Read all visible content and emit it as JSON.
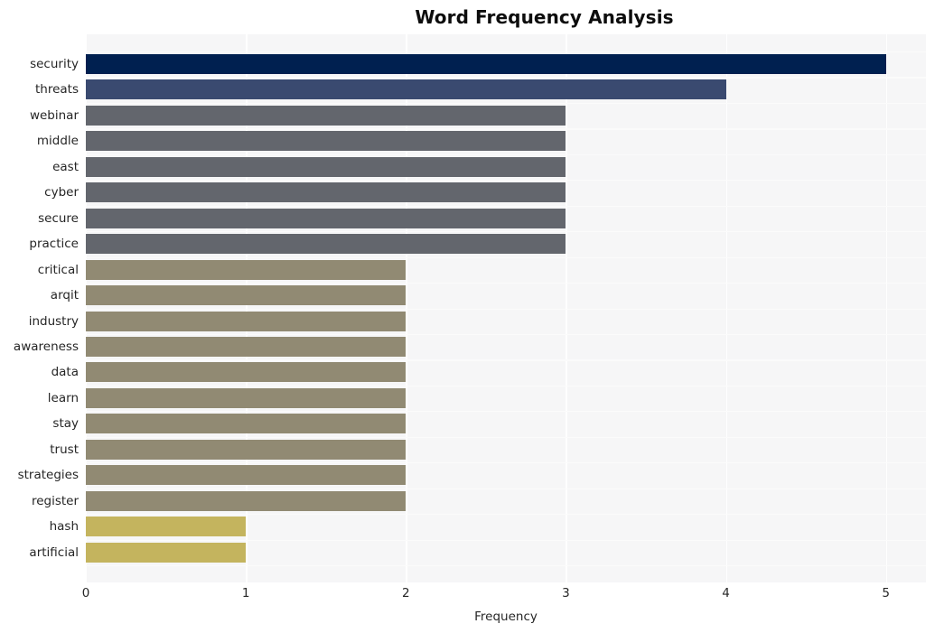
{
  "chart_data": {
    "type": "bar",
    "orientation": "horizontal",
    "title": "Word Frequency Analysis",
    "xlabel": "Frequency",
    "ylabel": "",
    "xlim": [
      0,
      5.25
    ],
    "xticks": [
      0,
      1,
      2,
      3,
      4,
      5
    ],
    "xtick_labels": [
      "0",
      "1",
      "2",
      "3",
      "4",
      "5"
    ],
    "grid": true,
    "legend": "none",
    "categories": [
      "security",
      "threats",
      "webinar",
      "middle",
      "east",
      "cyber",
      "secure",
      "practice",
      "critical",
      "arqit",
      "industry",
      "awareness",
      "data",
      "learn",
      "stay",
      "trust",
      "strategies",
      "register",
      "hash",
      "artificial"
    ],
    "values": [
      5,
      4,
      3,
      3,
      3,
      3,
      3,
      3,
      2,
      2,
      2,
      2,
      2,
      2,
      2,
      2,
      2,
      1,
      1
    ],
    "bars": [
      {
        "label": "security",
        "value": 5,
        "color": "#002050"
      },
      {
        "label": "threats",
        "value": 4,
        "color": "#3a4a70"
      },
      {
        "label": "webinar",
        "value": 3,
        "color": "#63666d"
      },
      {
        "label": "middle",
        "value": 3,
        "color": "#63666d"
      },
      {
        "label": "east",
        "value": 3,
        "color": "#63666d"
      },
      {
        "label": "cyber",
        "value": 3,
        "color": "#63666d"
      },
      {
        "label": "secure",
        "value": 3,
        "color": "#63666d"
      },
      {
        "label": "practice",
        "value": 3,
        "color": "#63666d"
      },
      {
        "label": "critical",
        "value": 2,
        "color": "#918a73"
      },
      {
        "label": "arqit",
        "value": 2,
        "color": "#918a73"
      },
      {
        "label": "industry",
        "value": 2,
        "color": "#918a73"
      },
      {
        "label": "awareness",
        "value": 2,
        "color": "#918a73"
      },
      {
        "label": "data",
        "value": 2,
        "color": "#918a73"
      },
      {
        "label": "learn",
        "value": 2,
        "color": "#918a73"
      },
      {
        "label": "stay",
        "value": 2,
        "color": "#918a73"
      },
      {
        "label": "trust",
        "value": 2,
        "color": "#918a73"
      },
      {
        "label": "strategies",
        "value": 2,
        "color": "#918a73"
      },
      {
        "label": "register",
        "value": 2,
        "color": "#918a73"
      },
      {
        "label": "hash",
        "value": 1,
        "color": "#c4b45e"
      },
      {
        "label": "artificial",
        "value": 1,
        "color": "#c4b45e"
      }
    ],
    "colors": {
      "value_5": "#002050",
      "value_4": "#3a4a70",
      "value_3": "#63666d",
      "value_2": "#918a73",
      "value_1": "#c4b45e",
      "plot_background": "#f6f6f7",
      "gridline": "#ffffff",
      "text": "#262626",
      "title": "#0d0d0d"
    }
  }
}
